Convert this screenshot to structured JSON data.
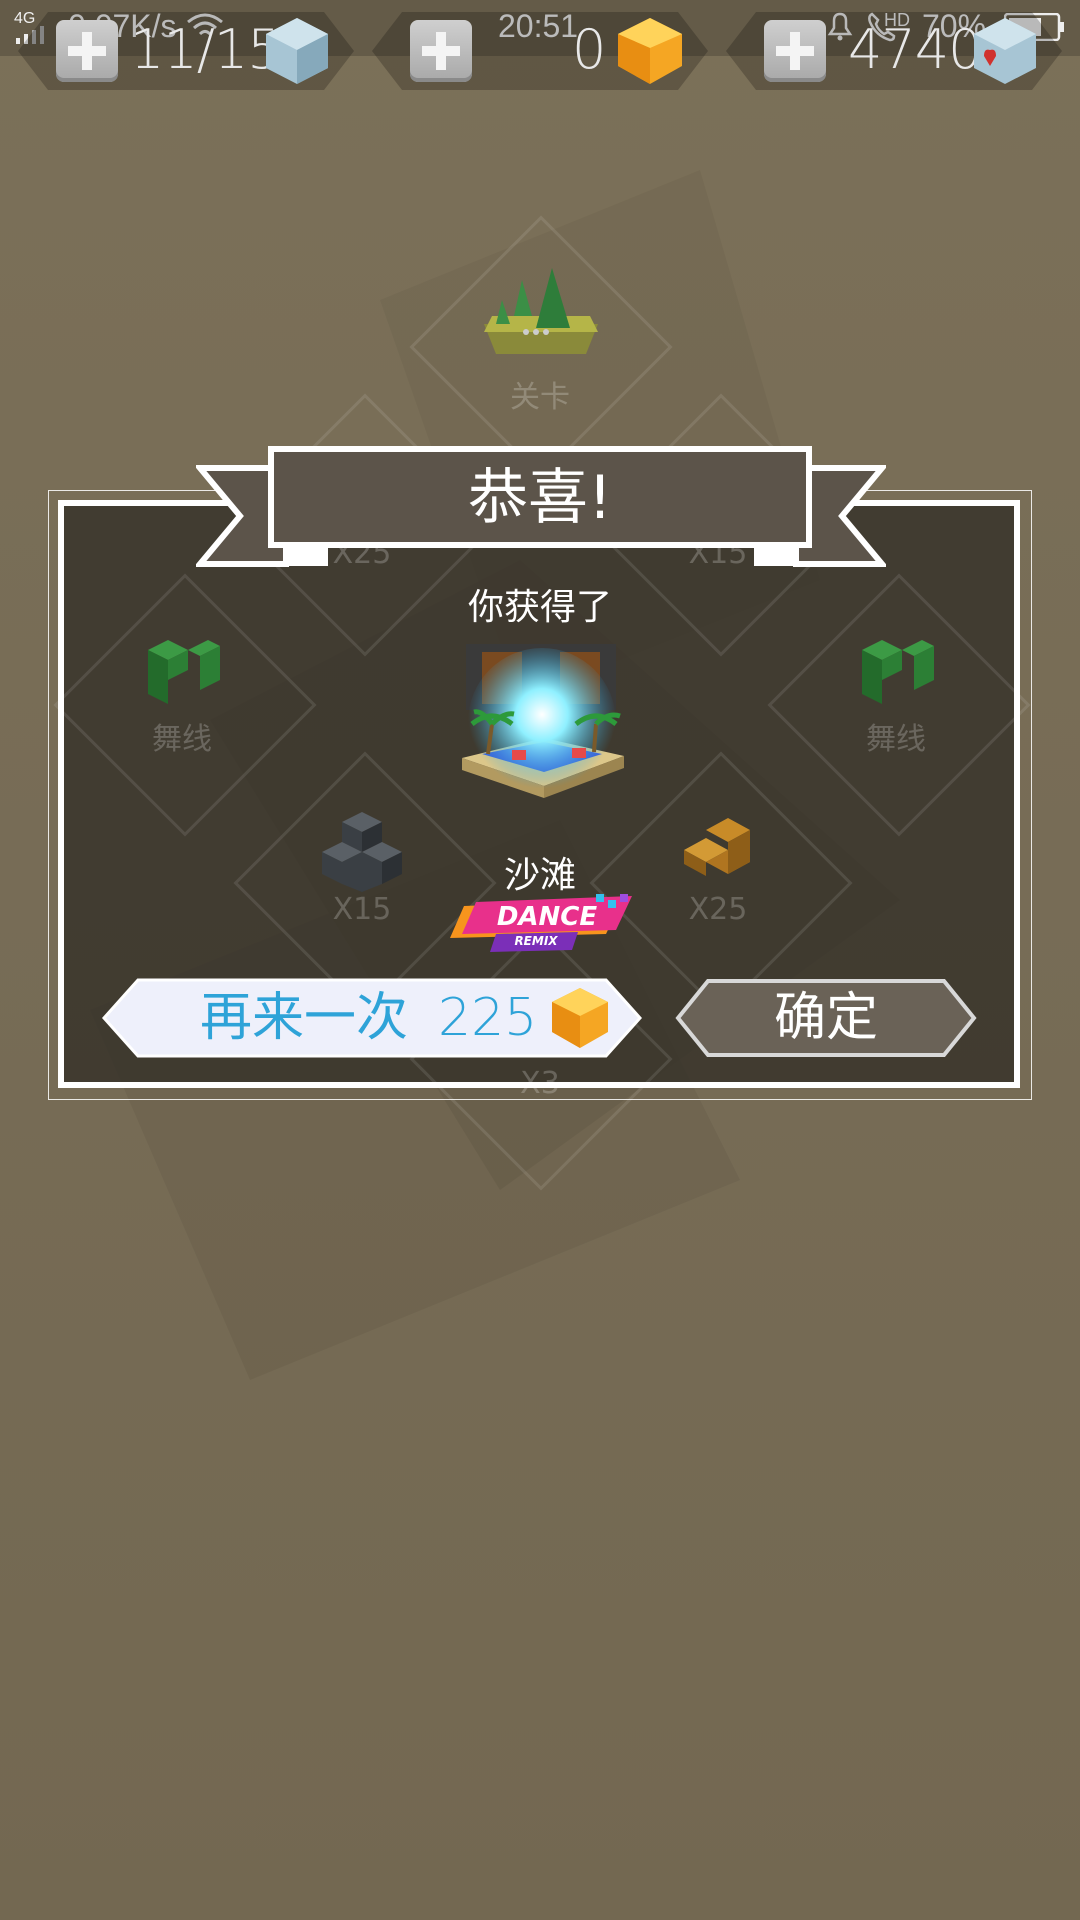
{
  "status_bar": {
    "network": "4G",
    "speed": "0.07K/s",
    "time": "20:51",
    "hd": "HD",
    "battery": "70%"
  },
  "resources": {
    "energy_value": "11/15",
    "gems_value": "0",
    "cubes_value": "4740"
  },
  "map": {
    "level_node_label": "关卡",
    "nodes": [
      {
        "label": "X25"
      },
      {
        "label": "X15"
      },
      {
        "label": "舞线"
      },
      {
        "label": "舞线"
      },
      {
        "label": "X15"
      },
      {
        "label": "X25"
      },
      {
        "label": "X3"
      }
    ]
  },
  "dialog": {
    "title": "恭喜!",
    "subtitle": "你获得了",
    "reward_name": "沙滩",
    "badge_text": "DANCE",
    "badge_sub": "REMIX",
    "retry_label": "再来一次",
    "retry_cost": "225",
    "confirm_label": "确定"
  },
  "colors": {
    "background": "#766b55",
    "dialog_bg": "#3a352d",
    "retry_text": "#2ea3d8",
    "gem_orange": "#f5a623"
  }
}
